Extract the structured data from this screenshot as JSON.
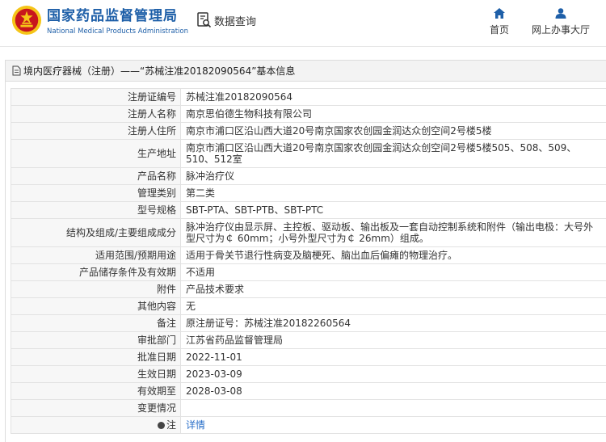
{
  "header": {
    "brand_cn": "国家药品监督管理局",
    "brand_en": "National Medical Products Administration",
    "query_label": "数据查询",
    "nav": {
      "home": "首页",
      "hall": "网上办事大厅"
    }
  },
  "panel": {
    "title": "境内医疗器械（注册）——“苏械注准20182090564”基本信息"
  },
  "rows": [
    {
      "label": "注册证编号",
      "value": "苏械注准20182090564"
    },
    {
      "label": "注册人名称",
      "value": "南京思伯德生物科技有限公司"
    },
    {
      "label": "注册人住所",
      "value": "南京市浦口区沿山西大道20号南京国家农创园金润达众创空间2号楼5楼"
    },
    {
      "label": "生产地址",
      "value": "南京市浦口区沿山西大道20号南京国家农创园金润达众创空间2号楼5楼505、508、509、510、512室"
    },
    {
      "label": "产品名称",
      "value": "脉冲治疗仪"
    },
    {
      "label": "管理类别",
      "value": "第二类"
    },
    {
      "label": "型号规格",
      "value": "SBT-PTA、SBT-PTB、SBT-PTC"
    },
    {
      "label": "结构及组成/主要组成成分",
      "value": "脉冲治疗仪由显示屏、主控板、驱动板、输出板及一套自动控制系统和附件（输出电极：大号外型尺寸为￠ 60mm；小号外型尺寸为￠ 26mm）组成。"
    },
    {
      "label": "适用范围/预期用途",
      "value": "适用于骨关节退行性病变及脑梗死、脑出血后偏瘫的物理治疗。"
    },
    {
      "label": "产品储存条件及有效期",
      "value": "不适用"
    },
    {
      "label": "附件",
      "value": "产品技术要求"
    },
    {
      "label": "其他内容",
      "value": "无"
    },
    {
      "label": "备注",
      "value": "原注册证号：苏械注准20182260564"
    },
    {
      "label": "审批部门",
      "value": "江苏省药品监督管理局"
    },
    {
      "label": "批准日期",
      "value": "2022-11-01"
    },
    {
      "label": "生效日期",
      "value": "2023-03-09"
    },
    {
      "label": "有效期至",
      "value": "2028-03-08"
    },
    {
      "label": "变更情况",
      "value": ""
    },
    {
      "label": "注",
      "value": "详情"
    }
  ],
  "colors": {
    "brand_blue": "#1e5fa8",
    "link_blue": "#2a6fc9",
    "emblem_red": "#c8161d",
    "emblem_gold": "#f5c518"
  }
}
